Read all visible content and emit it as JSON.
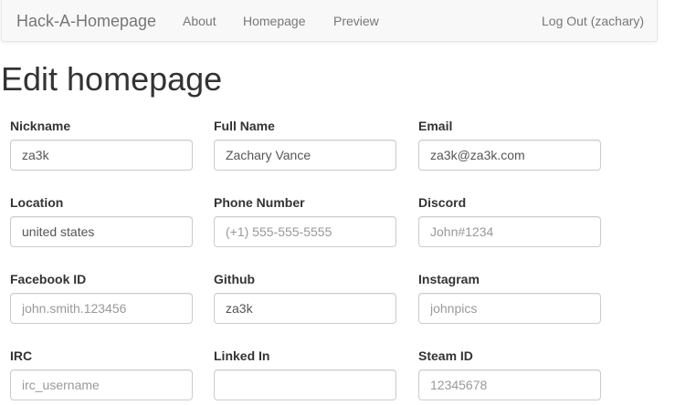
{
  "navbar": {
    "brand": "Hack-A-Homepage",
    "links": [
      {
        "label": "About"
      },
      {
        "label": "Homepage"
      },
      {
        "label": "Preview"
      }
    ],
    "logout": "Log Out (zachary)"
  },
  "page": {
    "title": "Edit homepage"
  },
  "form": {
    "nickname": {
      "label": "Nickname",
      "value": "za3k",
      "placeholder": ""
    },
    "full_name": {
      "label": "Full Name",
      "value": "Zachary Vance",
      "placeholder": ""
    },
    "email": {
      "label": "Email",
      "value": "za3k@za3k.com",
      "placeholder": ""
    },
    "location": {
      "label": "Location",
      "value": "united states",
      "placeholder": ""
    },
    "phone": {
      "label": "Phone Number",
      "value": "",
      "placeholder": "(+1) 555-555-5555"
    },
    "discord": {
      "label": "Discord",
      "value": "",
      "placeholder": "John#1234"
    },
    "facebook": {
      "label": "Facebook ID",
      "value": "",
      "placeholder": "john.smith.123456"
    },
    "github": {
      "label": "Github",
      "value": "za3k",
      "placeholder": ""
    },
    "instagram": {
      "label": "Instagram",
      "value": "",
      "placeholder": "johnpics"
    },
    "irc": {
      "label": "IRC",
      "value": "",
      "placeholder": "irc_username"
    },
    "linkedin": {
      "label": "Linked In",
      "value": "",
      "placeholder": ""
    },
    "steam": {
      "label": "Steam ID",
      "value": "",
      "placeholder": "12345678"
    }
  }
}
